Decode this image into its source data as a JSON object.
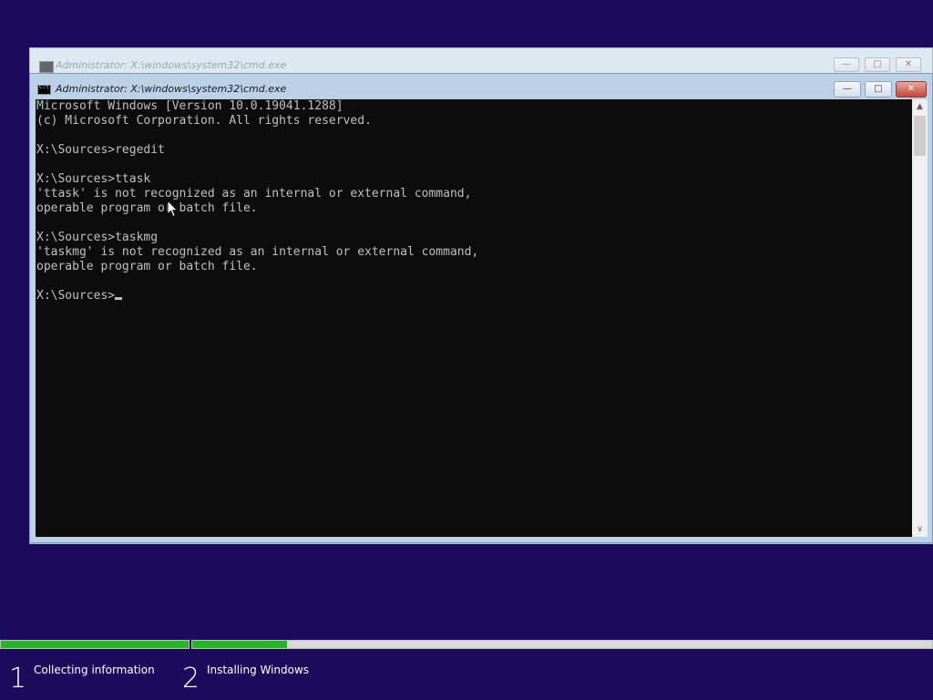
{
  "background_window": {
    "title": "Administrator: X:\\windows\\system32\\cmd.exe",
    "minimize_glyph": "—",
    "maximize_glyph": "□",
    "close_glyph": "✕"
  },
  "window": {
    "title": "Administrator: X:\\windows\\system32\\cmd.exe",
    "minimize_glyph": "—",
    "maximize_glyph": "□",
    "close_glyph": "✕",
    "icon": "cmd-console-icon"
  },
  "console": {
    "lines": [
      "Microsoft Windows [Version 10.0.19041.1288]",
      "(c) Microsoft Corporation. All rights reserved.",
      "",
      "X:\\Sources>regedit",
      "",
      "X:\\Sources>ttask",
      "'ttask' is not recognized as an internal or external command,",
      "operable program or batch file.",
      "",
      "X:\\Sources>taskmg",
      "'taskmg' is not recognized as an internal or external command,",
      "operable program or batch file.",
      ""
    ],
    "prompt": "X:\\Sources>",
    "text_color": "#c0c0c0",
    "background_color": "#0c0c0c"
  },
  "scrollbar": {
    "up_glyph": "▲",
    "down_glyph": "∨"
  },
  "setup": {
    "background_color": "#1c0a5c",
    "progress_color": "#27b427",
    "steps": [
      {
        "number": "1",
        "label": "Collecting information",
        "progress": 1.0
      },
      {
        "number": "2",
        "label": "Installing Windows",
        "progress": 0.128
      }
    ]
  }
}
